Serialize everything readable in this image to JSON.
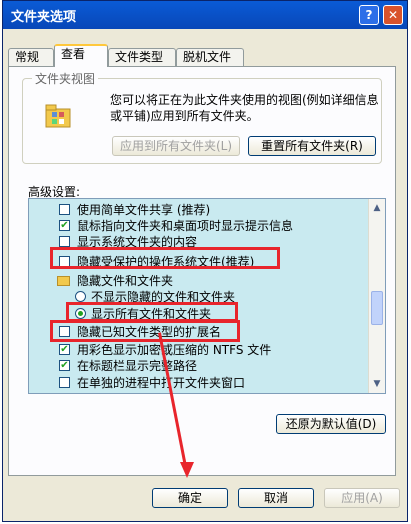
{
  "window": {
    "title": "文件夹选项",
    "help": "?",
    "close": "✕"
  },
  "tabs": [
    "常规",
    "查看",
    "文件类型",
    "脱机文件"
  ],
  "folder_view": {
    "label": "文件夹视图",
    "description": "您可以将正在为此文件夹使用的视图(例如详细信息或平铺)应用到所有文件夹。",
    "apply_all": "应用到所有文件夹(L)",
    "reset_all": "重置所有文件夹(R)"
  },
  "advanced": {
    "label": "高级设置:",
    "items": [
      "使用简单文件共享 (推荐)",
      "鼠标指向文件夹和桌面项时显示提示信息",
      "显示系统文件夹的内容",
      "隐藏受保护的操作系统文件(推荐)",
      "隐藏文件和文件夹",
      "不显示隐藏的文件和文件夹",
      "显示所有文件和文件夹",
      "隐藏已知文件类型的扩展名",
      "用彩色显示加密或压缩的 NTFS 文件",
      "在标题栏显示完整路径",
      "在单独的进程中打开文件夹窗口"
    ]
  },
  "restore_defaults": "还原为默认值(D)",
  "footer": {
    "ok": "确定",
    "cancel": "取消",
    "apply": "应用(A)"
  },
  "colors": {
    "highlight": "#e8252c",
    "list_bg": "#c9eaf0"
  }
}
